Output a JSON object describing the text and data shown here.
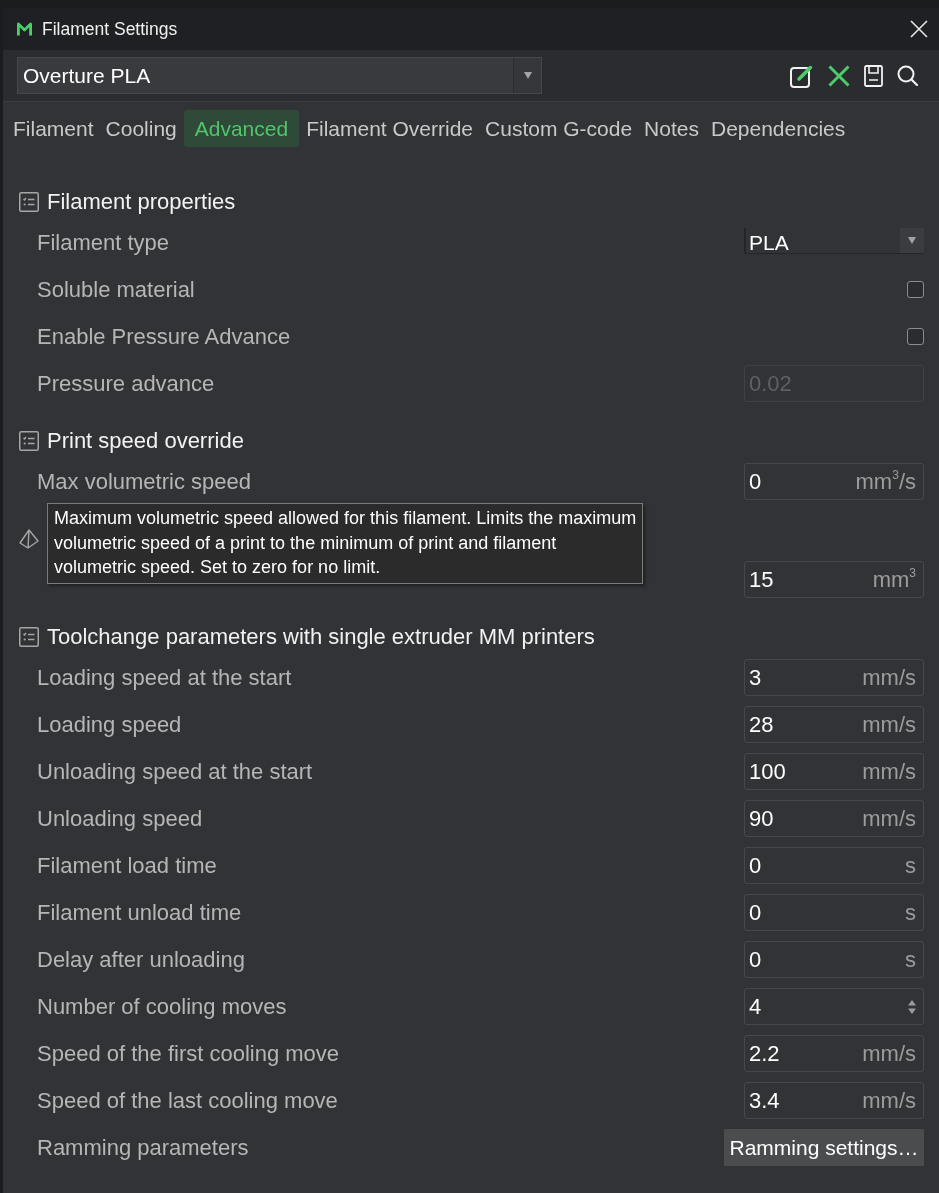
{
  "window": {
    "title": "Filament Settings"
  },
  "preset": {
    "value": "Overture PLA"
  },
  "tabs": [
    {
      "label": "Filament",
      "selected": false
    },
    {
      "label": "Cooling",
      "selected": false
    },
    {
      "label": "Advanced",
      "selected": true
    },
    {
      "label": "Filament Override",
      "selected": false
    },
    {
      "label": "Custom G-code",
      "selected": false
    },
    {
      "label": "Notes",
      "selected": false
    },
    {
      "label": "Dependencies",
      "selected": false
    }
  ],
  "sections": [
    {
      "kind": "list",
      "title": "Filament properties",
      "rows": [
        {
          "kind": "combo",
          "label": "Filament type",
          "value": "PLA",
          "disabled": false
        },
        {
          "kind": "checkbox",
          "label": "Soluble material",
          "checked": false,
          "disabled": false
        },
        {
          "kind": "checkbox",
          "label": "Enable Pressure Advance",
          "checked": false,
          "disabled": false
        },
        {
          "kind": "number",
          "label": "Pressure advance",
          "value": "0.02",
          "disabled": true
        }
      ]
    },
    {
      "kind": "list",
      "title": "Print speed override",
      "rows": [
        {
          "kind": "number",
          "label": "Max volumetric speed",
          "value": "0",
          "unit": "mm$^{3}$/s",
          "disabled": false
        }
      ]
    },
    {
      "kind": "tower",
      "rows": [
        {
          "kind": "number",
          "value": "15",
          "unit": "mm$^{3}$",
          "disabled": false
        }
      ]
    },
    {
      "kind": "list",
      "title": "Toolchange parameters with single extruder MM printers",
      "rows": [
        {
          "kind": "number",
          "label": "Loading speed at the start",
          "value": "3",
          "unit": "mm/s",
          "disabled": false
        },
        {
          "kind": "number",
          "label": "Loading speed",
          "value": "28",
          "unit": "mm/s",
          "disabled": false
        },
        {
          "kind": "number",
          "label": "Unloading speed at the start",
          "value": "100",
          "unit": "mm/s",
          "disabled": false
        },
        {
          "kind": "number",
          "label": "Unloading speed",
          "value": "90",
          "unit": "mm/s",
          "disabled": false
        },
        {
          "kind": "number",
          "label": "Filament load time",
          "value": "0",
          "unit": "s",
          "disabled": false
        },
        {
          "kind": "number",
          "label": "Filament unload time",
          "value": "0",
          "unit": "s",
          "disabled": false
        },
        {
          "kind": "number",
          "label": "Delay after unloading",
          "value": "0",
          "unit": "s",
          "disabled": false
        },
        {
          "kind": "spin",
          "label": "Number of cooling moves",
          "value": "4",
          "disabled": false
        },
        {
          "kind": "number",
          "label": "Speed of the first cooling move",
          "value": "2.2",
          "unit": "mm/s",
          "disabled": false
        },
        {
          "kind": "number",
          "label": "Speed of the last cooling move",
          "value": "3.4",
          "unit": "mm/s",
          "disabled": false
        },
        {
          "kind": "button",
          "label": "Ramming parameters",
          "button": "Ramming settings…",
          "disabled": false
        }
      ]
    }
  ],
  "tooltip": {
    "lines": [
      "Maximum volumetric speed allowed for this filament. Limits the maximum",
      "volumetric speed of a print to the minimum of print and filament",
      "volumetric speed. Set to zero for no limit."
    ]
  }
}
